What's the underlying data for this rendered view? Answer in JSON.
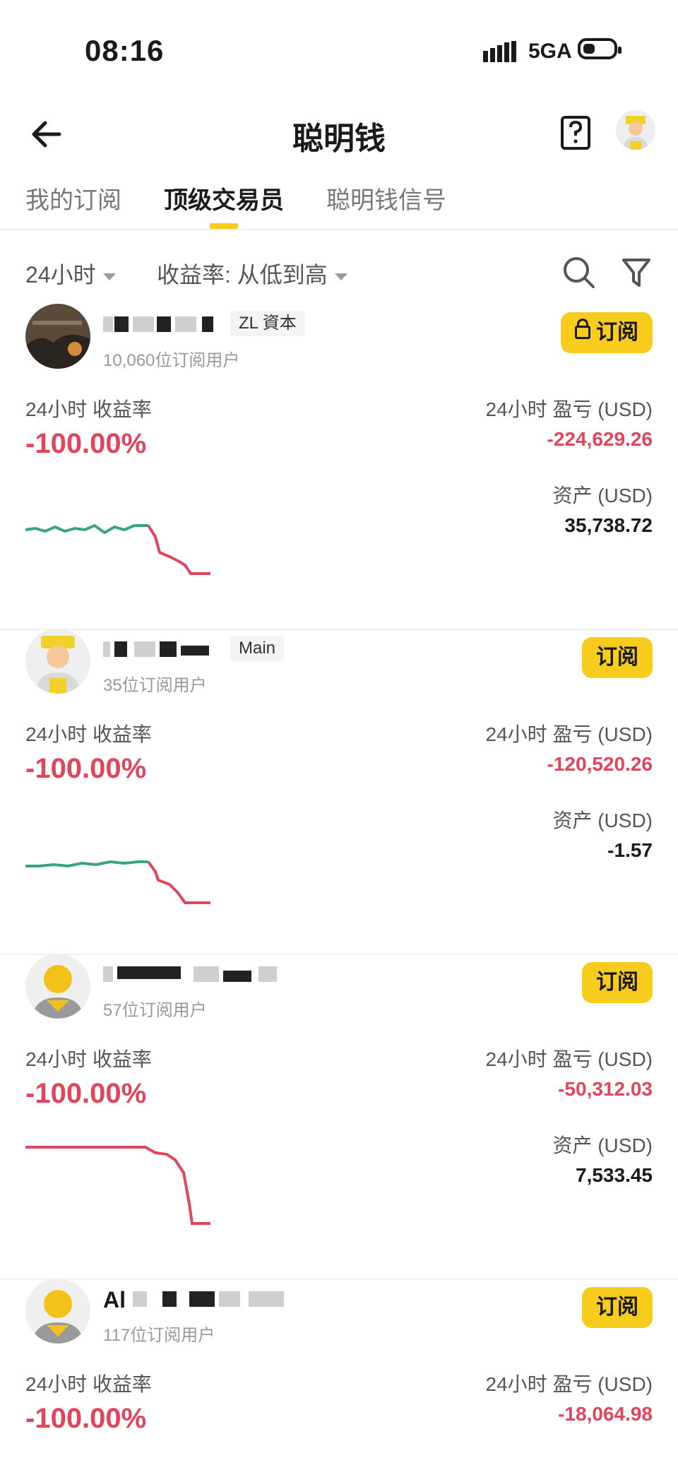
{
  "status_bar": {
    "time": "08:16",
    "network": "5GA"
  },
  "header": {
    "title": "聪明钱"
  },
  "tabs": [
    "我的订阅",
    "顶级交易员",
    "聪明钱信号"
  ],
  "filters": {
    "period": "24小时",
    "sort": "收益率: 从低到高"
  },
  "labels": {
    "roi_24h": "24小时 收益率",
    "pnl_24h": "24小时 盈亏 (USD)",
    "assets": "资产 (USD)",
    "subscribe": "订阅"
  },
  "traders": [
    {
      "tag": "ZL 資本",
      "subscribers": "10,060位订阅用户",
      "roi": "-100.00%",
      "pnl": "-224,629.26",
      "assets": "35,738.72",
      "locked": true
    },
    {
      "tag": "Main",
      "subscribers": "35位订阅用户",
      "roi": "-100.00%",
      "pnl": "-120,520.26",
      "assets": "-1.57",
      "locked": false
    },
    {
      "tag": "",
      "subscribers": "57位订阅用户",
      "roi": "-100.00%",
      "pnl": "-50,312.03",
      "assets": "7,533.45",
      "locked": false
    },
    {
      "name_prefix": "Al",
      "subscribers": "117位订阅用户",
      "roi": "-100.00%",
      "pnl": "-18,064.98",
      "locked": false
    }
  ],
  "colors": {
    "accent": "#f7cc1c",
    "loss": "#e0455b",
    "gain": "#3aa57a"
  }
}
